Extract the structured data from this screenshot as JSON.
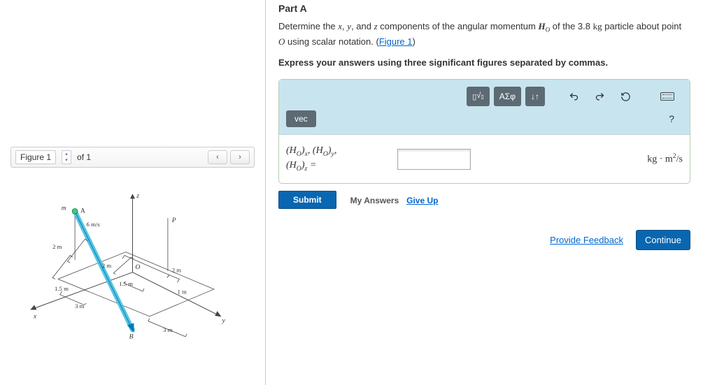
{
  "figure": {
    "label": "Figure 1",
    "count_text": "of 1",
    "labels": {
      "m": "m",
      "A": "A",
      "v": "6 m/s",
      "d_2m_a": "2 m",
      "d_2m_b": "2 m",
      "d_2m_c": "2 m",
      "d_1_5m_a": "1.5 m",
      "d_1_5m_b": "1.5 m",
      "d_1m": "1 m",
      "d_3m_a": "3 m",
      "d_3m_b": "3 m",
      "O": "O",
      "P": "P",
      "B": "B",
      "x": "x",
      "y": "y",
      "z": "z"
    }
  },
  "partA": {
    "title": "Part A",
    "prompt_prefix": "Determine the ",
    "prompt_vars": "x, y, and z",
    "prompt_mid": " components of the angular momentum ",
    "prompt_H": "H",
    "prompt_O": "O",
    "prompt_suffix1": " of the 3.8 ",
    "prompt_kg": "kg",
    "prompt_suffix2": " particle about point ",
    "prompt_O2": "O",
    "prompt_suffix3": " using scalar notation. (",
    "figure_link": "Figure 1",
    "prompt_close": ")",
    "instruction": "Express your answers using three significant figures separated by commas."
  },
  "toolbar": {
    "templates": "▯√▯",
    "greek": "ΑΣφ",
    "updown": "↓↑",
    "vec": "vec",
    "help": "?"
  },
  "answer": {
    "label_html": "(H_O)_x, (H_O)_y, (H_O)_z =",
    "value": "",
    "units": "kg · m²/s"
  },
  "actions": {
    "submit": "Submit",
    "my_answers": "My Answers",
    "give_up": "Give Up",
    "feedback": "Provide Feedback",
    "continue": "Continue"
  }
}
